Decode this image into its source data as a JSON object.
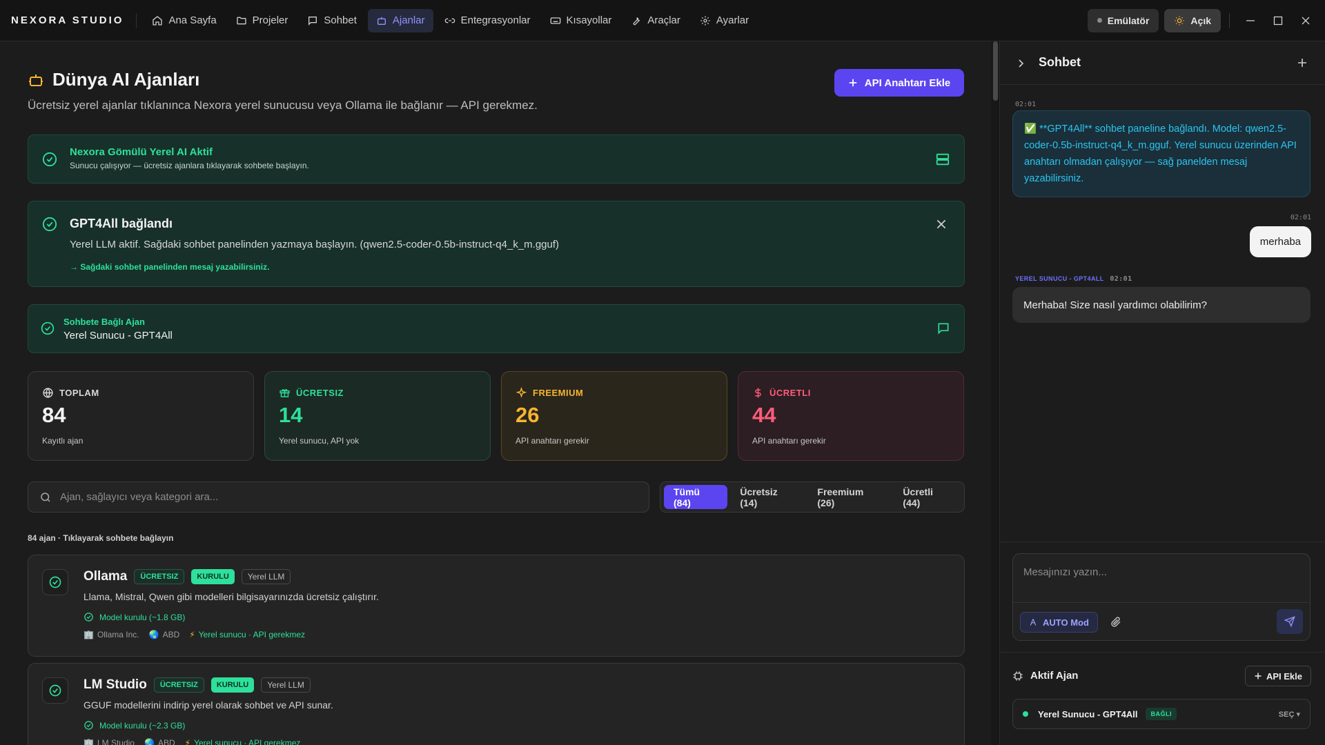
{
  "app": {
    "brand": "NEXORA STUDIO"
  },
  "nav": [
    {
      "label": "Ana Sayfa",
      "icon": "home-icon"
    },
    {
      "label": "Projeler",
      "icon": "folder-icon"
    },
    {
      "label": "Sohbet",
      "icon": "chat-icon"
    },
    {
      "label": "Ajanlar",
      "icon": "robot-icon",
      "active": true
    },
    {
      "label": "Entegrasyonlar",
      "icon": "link-icon"
    },
    {
      "label": "Kısayollar",
      "icon": "keyboard-icon"
    },
    {
      "label": "Araçlar",
      "icon": "wrench-icon"
    },
    {
      "label": "Ayarlar",
      "icon": "gear-icon"
    }
  ],
  "topbar": {
    "emulator_label": "Emülatör",
    "theme_label": "Açık"
  },
  "page": {
    "title": "Dünya AI Ajanları",
    "subtitle": "Ücretsiz yerel ajanlar tıklanınca Nexora yerel sunucusu veya Ollama ile bağlanır — API gerekmez.",
    "api_button": "API Anahtarı Ekle"
  },
  "banners": {
    "embedded": {
      "title": "Nexora Gömülü Yerel AI Aktif",
      "text": "Sunucu çalışıyor — ücretsiz ajanlara tıklayarak sohbete başlayın."
    },
    "connected": {
      "title": "GPT4All bağlandı",
      "text": "Yerel LLM aktif. Sağdaki sohbet panelinden yazmaya başlayın. (qwen2.5-coder-0.5b-instruct-q4_k_m.gguf)",
      "hint": "→ Sağdaki sohbet panelinden mesaj yazabilirsiniz."
    },
    "chat_agent": {
      "title": "Sohbete Bağlı Ajan",
      "value": "Yerel Sunucu - GPT4All"
    }
  },
  "stats": [
    {
      "label": "TOPLAM",
      "value": "84",
      "sub": "Kayıtlı ajan",
      "icon": "globe-icon"
    },
    {
      "label": "ÜCRETSIZ",
      "value": "14",
      "sub": "Yerel sunucu, API yok",
      "icon": "gift-icon"
    },
    {
      "label": "FREEMIUM",
      "value": "26",
      "sub": "API anahtarı gerekir",
      "icon": "sparkle-icon"
    },
    {
      "label": "ÜCRETLI",
      "value": "44",
      "sub": "API anahtarı gerekir",
      "icon": "dollar-icon"
    }
  ],
  "search": {
    "placeholder": "Ajan, sağlayıcı veya kategori ara..."
  },
  "filters": [
    "Tümü (84)",
    "Ücretsiz (14)",
    "Freemium (26)",
    "Ücretli (44)"
  ],
  "list_count": "84 ajan · Tıklayarak sohbete bağlayın",
  "agents": [
    {
      "name": "Ollama",
      "tag_price": "ÜCRETSIZ",
      "tag_status": "KURULU",
      "tag_type": "Yerel LLM",
      "description": "Llama, Mistral, Qwen gibi modelleri bilgisayarınızda ücretsiz çalıştırır.",
      "model": "Model kurulu (~1.8 GB)",
      "company": "Ollama Inc.",
      "country": "ABD",
      "server": "Yerel sunucu · API gerekmez"
    },
    {
      "name": "LM Studio",
      "tag_price": "ÜCRETSIZ",
      "tag_status": "KURULU",
      "tag_type": "Yerel LLM",
      "description": "GGUF modellerini indirip yerel olarak sohbet ve API sunar.",
      "model": "Model kurulu (~2.3 GB)",
      "company": "LM Studio",
      "country": "ABD",
      "server": "Yerel sunucu · API gerekmez"
    }
  ],
  "chat": {
    "title": "Sohbet",
    "messages": [
      {
        "role": "system",
        "time": "02:01",
        "text": "✅ **GPT4All** sohbet paneline bağlandı. Model: qwen2.5-coder-0.5b-instruct-q4_k_m.gguf. Yerel sunucu üzerinden API anahtarı olmadan çalışıyor — sağ panelden mesaj yazabilirsiniz."
      },
      {
        "role": "user",
        "time": "02:01",
        "text": "merhaba"
      },
      {
        "role": "agent",
        "sender": "YEREL SUNUCU - GPT4ALL",
        "time": "02:01",
        "text": "Merhaba! Size nasıl yardımcı olabilirim?"
      }
    ],
    "input_placeholder": "Mesajınızı yazın...",
    "mode_label": "AUTO Mod"
  },
  "active_agent": {
    "title": "Aktif Ajan",
    "add_api": "API Ekle",
    "name": "Yerel Sunucu - GPT4All",
    "badge": "BAĞLI",
    "select": "SEÇ ▾"
  }
}
